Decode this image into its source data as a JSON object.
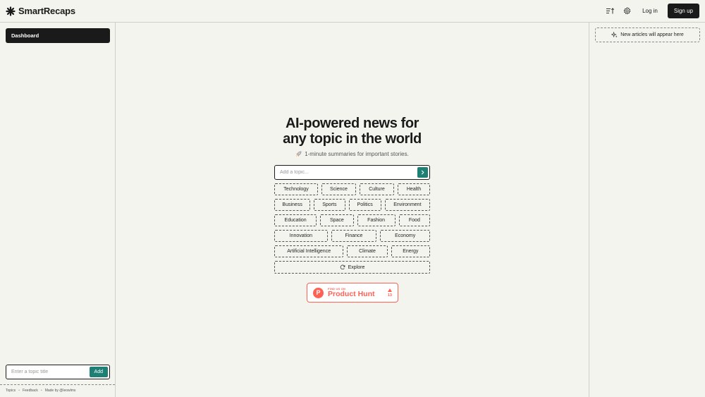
{
  "header": {
    "brand": "SmartRecaps",
    "login_label": "Log in",
    "signup_label": "Sign up"
  },
  "left_sidebar": {
    "dashboard_label": "Dashboard",
    "topic_input_placeholder": "Enter a topic title",
    "add_label": "Add",
    "footer_links": [
      "Topics",
      "Feedback",
      "Made by @leowlms"
    ]
  },
  "right_sidebar": {
    "new_articles_label": "New articles will appear here"
  },
  "hero": {
    "title_line1": "AI-powered news for",
    "title_line2": "any topic in the world",
    "subtitle": "1-minute summaries for important stories."
  },
  "search": {
    "placeholder": "Add a topic..."
  },
  "topic_rows": [
    [
      "Technology",
      "Science",
      "Culture",
      "Health"
    ],
    [
      "Business",
      "Sports",
      "Politics",
      "Environment"
    ],
    [
      "Education",
      "Space",
      "Fashion",
      "Food"
    ],
    [
      "Innovation",
      "Finance",
      "Economy"
    ],
    [
      "Artificial Intelligence",
      "Climate",
      "Energy"
    ]
  ],
  "explore_label": "Explore",
  "product_hunt": {
    "small": "FIND US ON",
    "big": "Product Hunt",
    "votes": "13"
  },
  "colors": {
    "accent": "#1e7f74",
    "dark": "#1a1a1a",
    "background": "#f4f4ef",
    "product_hunt": "#ff6154"
  }
}
